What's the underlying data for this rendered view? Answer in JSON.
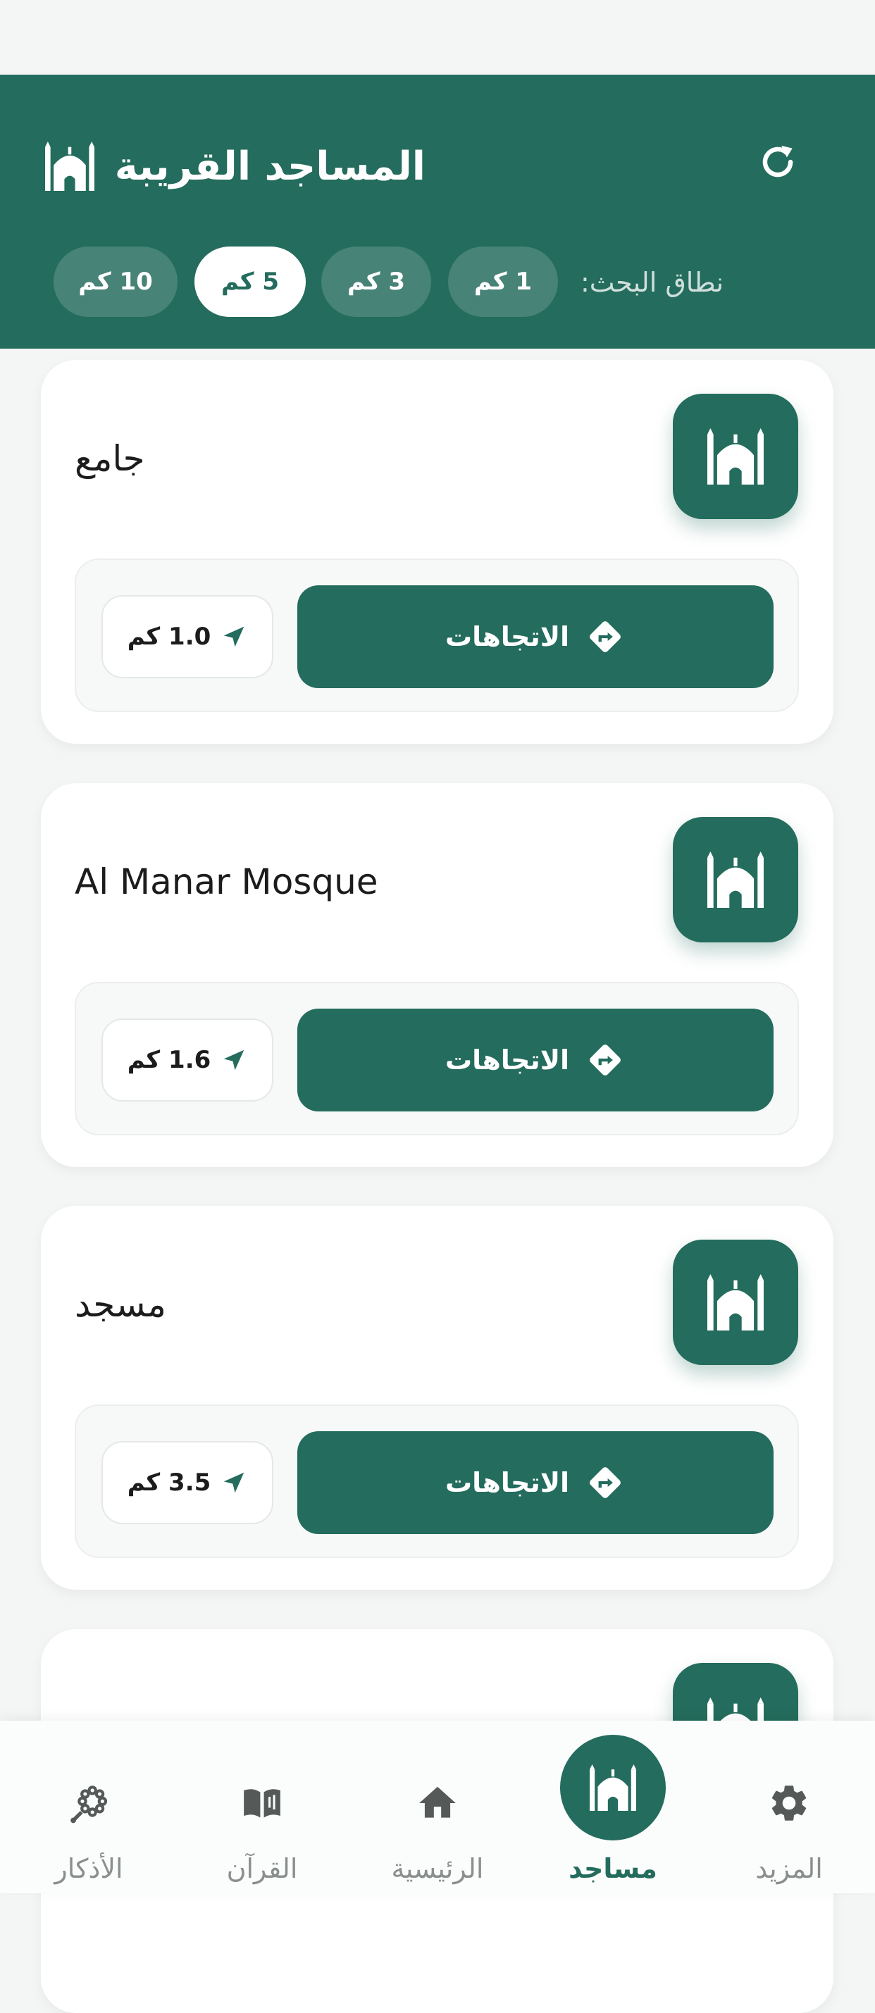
{
  "header": {
    "title": "المساجد القريبة",
    "range_label": "نطاق البحث:",
    "range_options": [
      {
        "label": "1 كم",
        "selected": false
      },
      {
        "label": "3 كم",
        "selected": false
      },
      {
        "label": "5 كم",
        "selected": true
      },
      {
        "label": "10 كم",
        "selected": false
      }
    ],
    "icons": {
      "title_icon": "mosque-icon",
      "refresh_icon": "refresh-icon"
    }
  },
  "mosques": [
    {
      "name": "جامع",
      "directions_label": "الاتجاهات",
      "distance": "1.0 كم"
    },
    {
      "name": "Al Manar Mosque",
      "directions_label": "الاتجاهات",
      "distance": "1.6 كم"
    },
    {
      "name": "مسجد",
      "directions_label": "الاتجاهات",
      "distance": "3.5 كم"
    },
    {
      "name": "",
      "directions_label": "",
      "distance": ""
    }
  ],
  "bottom_nav": {
    "items": [
      {
        "label": "المزيد",
        "icon": "gear-icon",
        "active": false
      },
      {
        "label": "مساجد",
        "icon": "mosque-icon",
        "active": true
      },
      {
        "label": "الرئيسية",
        "icon": "home-icon",
        "active": false
      },
      {
        "label": "القرآن",
        "icon": "book-icon",
        "active": false
      },
      {
        "label": "الأذكار",
        "icon": "prayer-beads-icon",
        "active": false
      }
    ]
  },
  "colors": {
    "primary": "#246c5d",
    "background": "#f4f5f5",
    "card": "#ffffff",
    "muted_text": "#8a8f8e"
  }
}
